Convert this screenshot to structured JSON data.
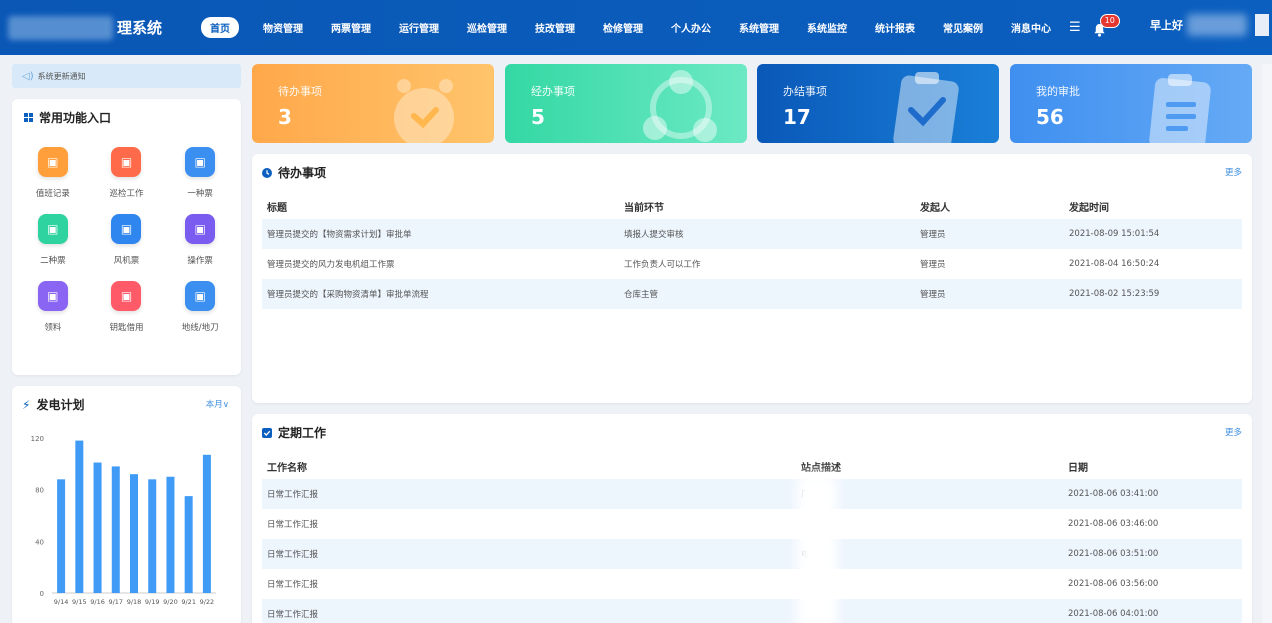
{
  "header": {
    "title": "理系统",
    "nav": [
      "首页",
      "物资管理",
      "两票管理",
      "运行管理",
      "巡检管理",
      "技改管理",
      "检修管理",
      "个人办公",
      "系统管理",
      "系统监控",
      "统计报表",
      "常见案例",
      "消息中心"
    ],
    "badge": "10",
    "greeting": "早上好"
  },
  "notice": {
    "text": "系统更新通知"
  },
  "quick": {
    "title": "常用功能入口",
    "items": [
      {
        "label": "值班记录",
        "icon": "duty-record-icon",
        "color": "#ff9f3b"
      },
      {
        "label": "巡检工作",
        "icon": "inspection-icon",
        "color": "#ff6b4a"
      },
      {
        "label": "一种票",
        "icon": "ticket-one-icon",
        "color": "#3b8ff0"
      },
      {
        "label": "二种票",
        "icon": "ticket-two-icon",
        "color": "#2fd39f"
      },
      {
        "label": "风机票",
        "icon": "fan-ticket-icon",
        "color": "#2f86ee"
      },
      {
        "label": "操作票",
        "icon": "operation-ticket-icon",
        "color": "#7a5cf0"
      },
      {
        "label": "领料",
        "icon": "material-icon",
        "color": "#8a64f2"
      },
      {
        "label": "钥匙借用",
        "icon": "key-icon",
        "color": "#ff5a67"
      },
      {
        "label": "地线/地刀",
        "icon": "ground-wire-icon",
        "color": "#3b8ff0"
      }
    ]
  },
  "plan": {
    "title": "发电计划",
    "period": "本月",
    "chart_data": {
      "type": "bar",
      "categories": [
        "9/14",
        "9/15",
        "9/16",
        "9/17",
        "9/18",
        "9/19",
        "9/20",
        "9/21",
        "9/22"
      ],
      "values": [
        88,
        118,
        101,
        98,
        92,
        88,
        90,
        75,
        107
      ],
      "ylim": [
        0,
        120
      ],
      "yticks": [
        0,
        40,
        80,
        120
      ],
      "color": "#3f9bf5",
      "grid": false
    }
  },
  "stats": [
    {
      "label": "待办事项",
      "value": "3"
    },
    {
      "label": "经办事项",
      "value": "5"
    },
    {
      "label": "办结事项",
      "value": "17"
    },
    {
      "label": "我的审批",
      "value": "56"
    }
  ],
  "todo": {
    "title": "待办事项",
    "more": "更多",
    "columns": [
      "标题",
      "当前环节",
      "发起人",
      "发起时间"
    ],
    "rows": [
      [
        "管理员提交的【物资需求计划】审批单",
        "填报人提交审核",
        "管理员",
        "2021-08-09 15:01:54"
      ],
      [
        "管理员提交的风力发电机组工作票",
        "工作负责人可以工作",
        "管理员",
        "2021-08-04 16:50:24"
      ],
      [
        "管理员提交的【采购物资清单】审批单流程",
        "仓库主管",
        "管理员",
        "2021-08-02 15:23:59"
      ]
    ]
  },
  "periodic": {
    "title": "定期工作",
    "more": "更多",
    "columns": [
      "工作名称",
      "站点描述",
      "日期"
    ],
    "rows": [
      [
        "日常工作汇报",
        "厂",
        "2021-08-06 03:41:00"
      ],
      [
        "日常工作汇报",
        "",
        "2021-08-06 03:46:00"
      ],
      [
        "日常工作汇报",
        "电",
        "2021-08-06 03:51:00"
      ],
      [
        "日常工作汇报",
        "",
        "2021-08-06 03:56:00"
      ],
      [
        "日常工作汇报",
        "",
        "2021-08-06 04:01:00"
      ]
    ]
  }
}
